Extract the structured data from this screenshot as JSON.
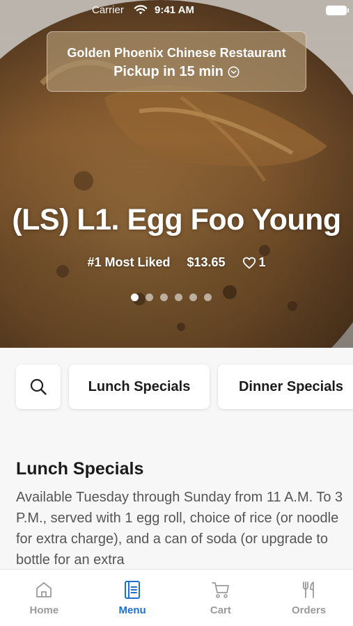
{
  "status_bar": {
    "carrier": "Carrier",
    "time": "9:41 AM"
  },
  "header": {
    "restaurant_name": "Golden Phoenix Chinese Restaurant",
    "pickup_text": "Pickup in 15 min",
    "pickup_icon": "chevron-circle-down-icon"
  },
  "featured_item": {
    "title": "(LS) L1. Egg Foo Young",
    "badge": "#1 Most Liked",
    "price": "$13.65",
    "likes": "1",
    "carousel_pages": 6,
    "carousel_active_index": 0
  },
  "categories": {
    "search_icon": "search-icon",
    "items": [
      "Lunch Specials",
      "Dinner Specials"
    ]
  },
  "section": {
    "title": "Lunch Specials",
    "description": "Available Tuesday through Sunday from 11 A.M. To 3 P.M., served with 1 egg roll, choice of rice (or noodle for extra charge), and a can of soda (or upgrade to bottle for an extra"
  },
  "tabs": [
    {
      "label": "Home",
      "icon": "home-icon",
      "active": false
    },
    {
      "label": "Menu",
      "icon": "menu-book-icon",
      "active": true
    },
    {
      "label": "Cart",
      "icon": "cart-icon",
      "active": false
    },
    {
      "label": "Orders",
      "icon": "fork-knife-icon",
      "active": false
    }
  ],
  "colors": {
    "accent": "#1f6fd1",
    "inactive_tab": "#9a9a9a"
  }
}
